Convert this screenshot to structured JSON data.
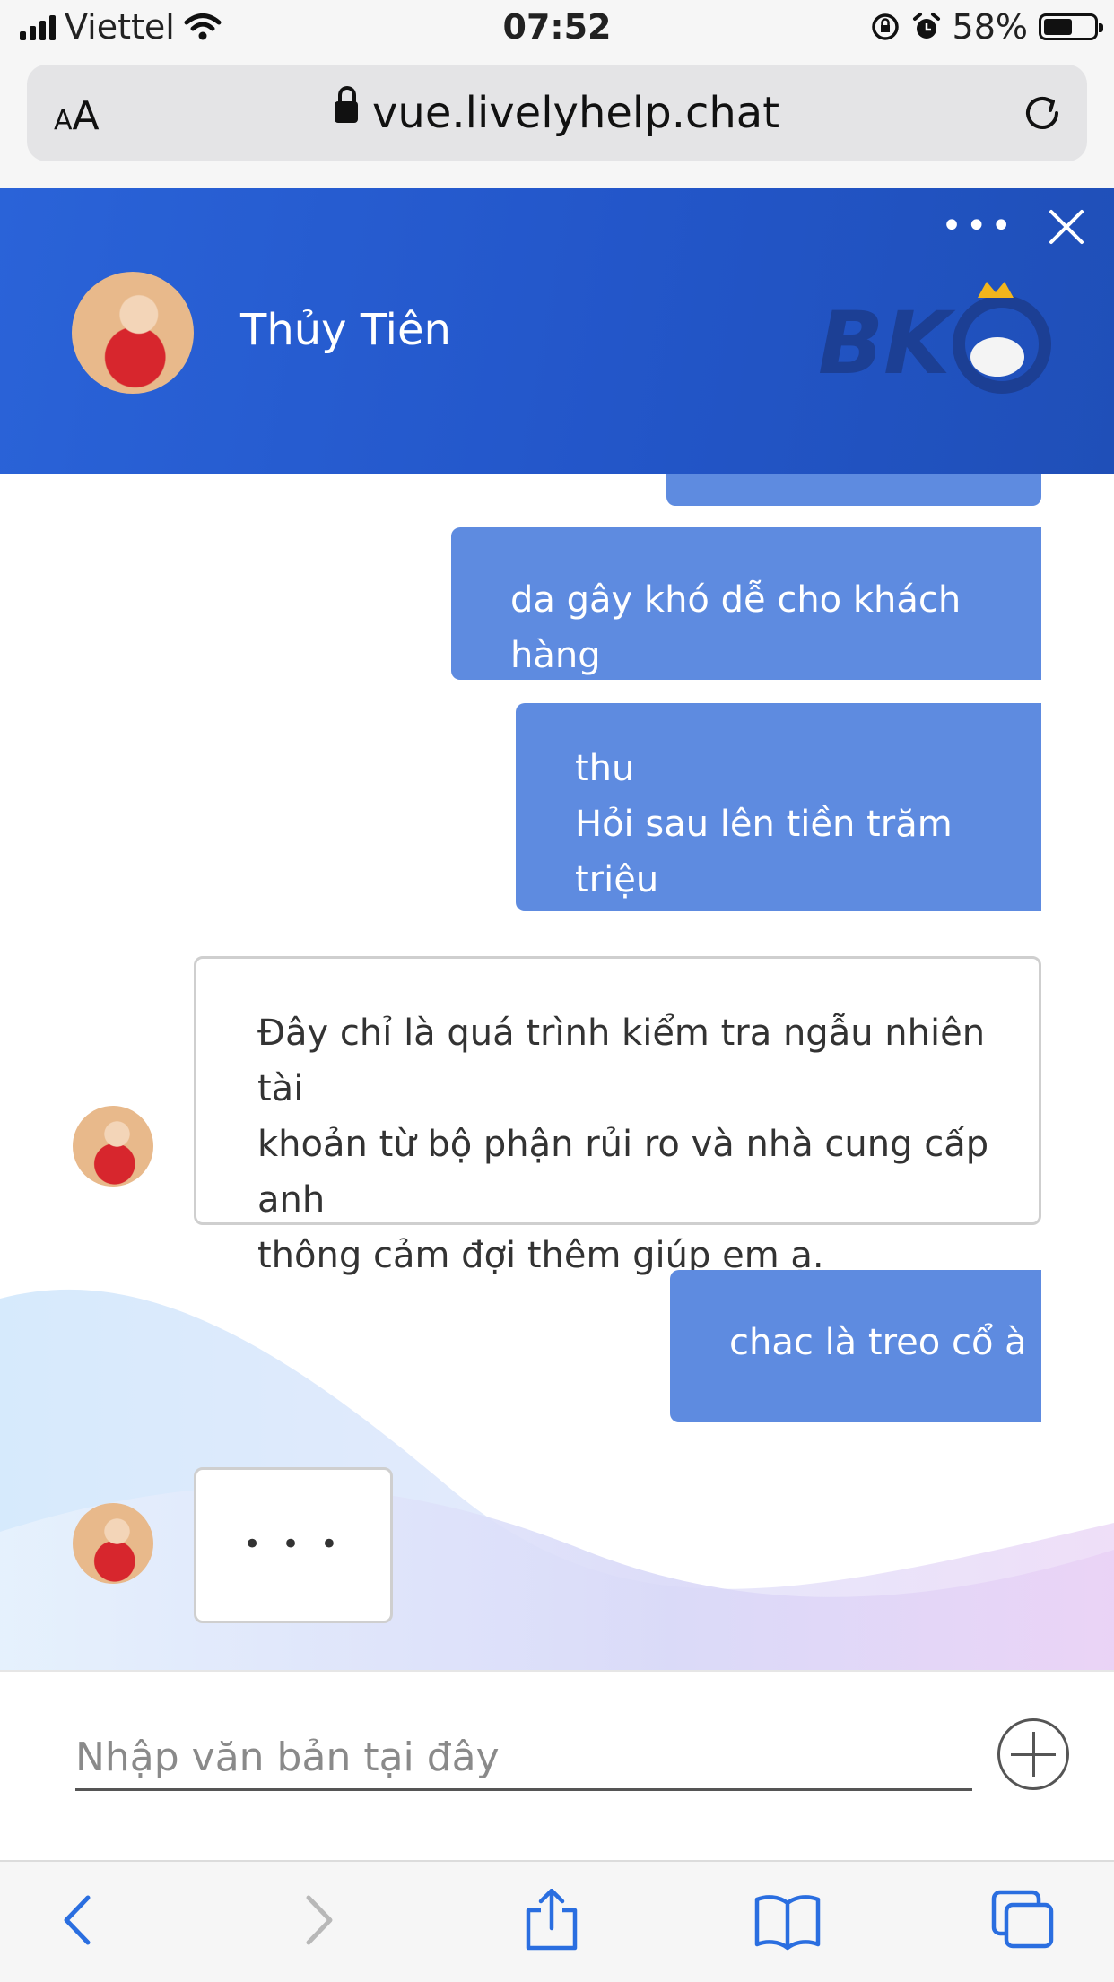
{
  "status_bar": {
    "carrier": "Viettel",
    "time": "07:52",
    "battery_percent": "58%",
    "battery_level": 0.58
  },
  "browser": {
    "text_size_label": "AA",
    "url": "vue.livelyhelp.chat"
  },
  "chat_header": {
    "agent_name": "Thủy Tiên",
    "brand_logo_text": "BK8"
  },
  "messages": [
    {
      "from": "user",
      "text": "da gây khó dễ cho khách hàng"
    },
    {
      "from": "user",
      "lines": [
        "thu",
        "Hỏi sau lên tiền trăm triệu"
      ]
    },
    {
      "from": "agent",
      "lines": [
        "Đây chỉ là quá trình kiểm tra ngẫu nhiên tài",
        "khoản từ bộ phận rủi ro và nhà cung cấp anh",
        "thông cảm đợi thêm giúp em ạ."
      ]
    },
    {
      "from": "user",
      "text": "chac là treo cổ à"
    },
    {
      "from": "agent",
      "typing": "• • •"
    }
  ],
  "composer": {
    "placeholder": "Nhập văn bản tại đây"
  },
  "colors": {
    "header": "#2356c9",
    "user_bubble": "#5e8be0"
  }
}
